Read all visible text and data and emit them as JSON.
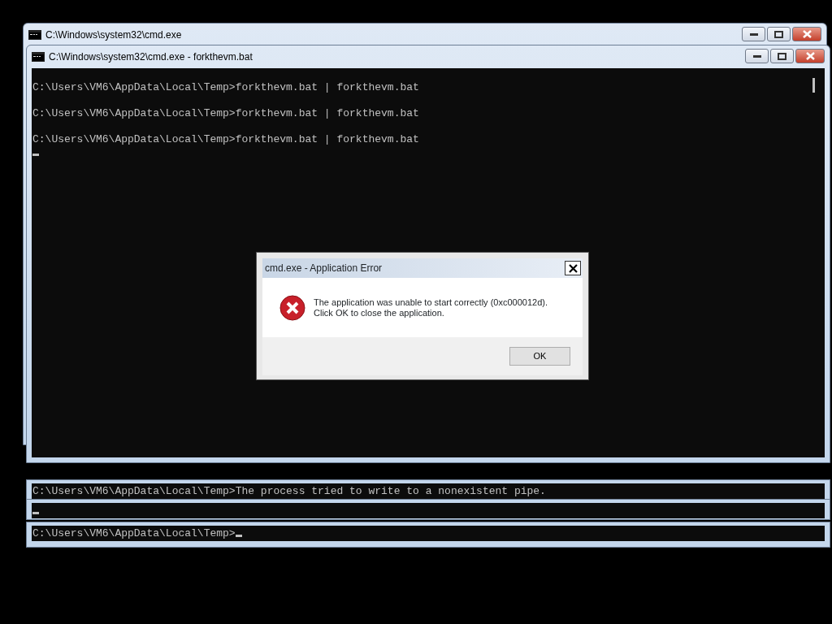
{
  "back_window": {
    "title": "C:\\Windows\\system32\\cmd.exe"
  },
  "front_window": {
    "title": "C:\\Windows\\system32\\cmd.exe - forkthevm.bat",
    "lines": [
      "C:\\Users\\VM6\\AppData\\Local\\Temp>forkthevm.bat | forkthevm.bat",
      "C:\\Users\\VM6\\AppData\\Local\\Temp>forkthevm.bat | forkthevm.bat",
      "C:\\Users\\VM6\\AppData\\Local\\Temp>forkthevm.bat | forkthevm.bat"
    ],
    "cursor": true
  },
  "lower_consoles": [
    {
      "text": "C:\\Users\\VM6\\AppData\\Local\\Temp>The process tried to write to a nonexistent pipe.",
      "cursor": false
    },
    {
      "cursor": true
    },
    {
      "text": "C:\\Users\\VM6\\AppData\\Local\\Temp>",
      "cursor": true
    }
  ],
  "dialog": {
    "title": "cmd.exe - Application Error",
    "message": [
      "The application was unable to start correctly (0xc000012d).",
      "Click OK to close the application."
    ],
    "button": "OK"
  }
}
